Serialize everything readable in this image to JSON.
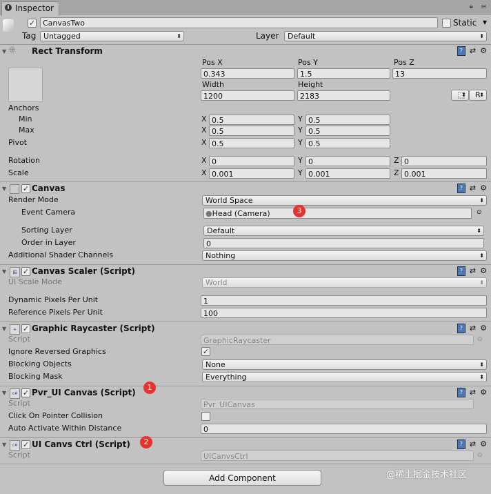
{
  "tab": {
    "title": "Inspector"
  },
  "object": {
    "name": "CanvasTwo",
    "static_label": "Static",
    "tag_label": "Tag",
    "tag": "Untagged",
    "layer_label": "Layer",
    "layer": "Default"
  },
  "rect": {
    "title": "Rect Transform",
    "pos_x_label": "Pos X",
    "pos_y_label": "Pos Y",
    "pos_z_label": "Pos Z",
    "pos_x": "0.343",
    "pos_y": "1.5",
    "pos_z": "13",
    "width_label": "Width",
    "height_label": "Height",
    "width": "1200",
    "height": "2183",
    "r_label": "R",
    "anchors": "Anchors",
    "min": "Min",
    "max": "Max",
    "pivot": "Pivot",
    "rotation": "Rotation",
    "scale": "Scale",
    "x": "X",
    "y": "Y",
    "z": "Z",
    "min_x": "0.5",
    "min_y": "0.5",
    "max_x": "0.5",
    "max_y": "0.5",
    "pivot_x": "0.5",
    "pivot_y": "0.5",
    "rot_x": "0",
    "rot_y": "0",
    "rot_z": "0",
    "scale_x": "0.001",
    "scale_y": "0.001",
    "scale_z": "0.001"
  },
  "canvas": {
    "title": "Canvas",
    "render_mode_label": "Render Mode",
    "render_mode": "World Space",
    "event_camera_label": "Event Camera",
    "event_camera": "Head (Camera)",
    "sorting_layer_label": "Sorting Layer",
    "sorting_layer": "Default",
    "order_label": "Order in Layer",
    "order": "0",
    "shader_label": "Additional Shader Channels",
    "shader": "Nothing"
  },
  "scaler": {
    "title": "Canvas Scaler (Script)",
    "mode_label": "UI Scale Mode",
    "mode": "World",
    "dpp_label": "Dynamic Pixels Per Unit",
    "dpp": "1",
    "rpp_label": "Reference Pixels Per Unit",
    "rpp": "100"
  },
  "raycaster": {
    "title": "Graphic Raycaster (Script)",
    "script_label": "Script",
    "script": "GraphicRaycaster",
    "ignore_label": "Ignore Reversed Graphics",
    "blocking_objects_label": "Blocking Objects",
    "blocking_objects": "None",
    "blocking_mask_label": "Blocking Mask",
    "blocking_mask": "Everything"
  },
  "pvr": {
    "title": "Pvr_UI Canvas (Script)",
    "script_label": "Script",
    "script": "Pvr_UICanvas",
    "click_label": "Click On Pointer Collision",
    "auto_label": "Auto Activate Within Distance",
    "auto": "0"
  },
  "ctrl": {
    "title": "UI Canvs Ctrl (Script)",
    "script_label": "Script",
    "script": "UICanvsCtrl"
  },
  "add_component": "Add Component",
  "badges": [
    "1",
    "2",
    "3"
  ],
  "watermark": "@稀土掘金技术社区"
}
